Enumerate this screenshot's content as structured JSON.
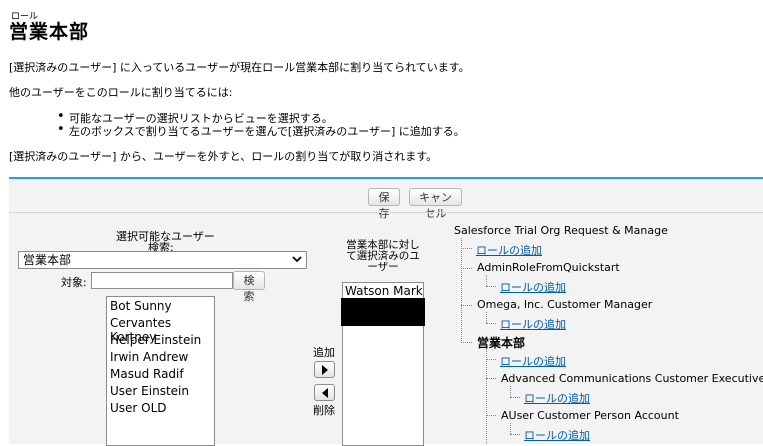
{
  "header": {
    "breadcrumb": "ロール",
    "title": "営業本部"
  },
  "intro": {
    "line1": "[選択済みのユーザー] に入っているユーザーが現在ロール営業本部に割り当てられています。",
    "line2": "他のユーザーをこのロールに割り当てるには:",
    "bullets": [
      "可能なユーザーの選択リストからビューを選択する。",
      "左のボックスで割り当てるユーザーを選んで[選択済みのユーザー] に追加する。"
    ],
    "line3": "[選択済みのユーザー] から、ユーザーを外すと、ロールの割り当てが取り消されます。"
  },
  "toolbar": {
    "save_label": "保存",
    "cancel_label": "キャンセル"
  },
  "available": {
    "heading_line1": "選択可能なユーザー",
    "heading_line2": "検索:",
    "view_selected": "営業本部",
    "target_label": "対象:",
    "search_value": "",
    "search_button": "検索",
    "users": [
      "Bot Sunny",
      "Cervantes Kortney",
      "Helper Einstein",
      "Irwin Andrew",
      "Masud Radif",
      "User Einstein",
      "User OLD"
    ]
  },
  "mover": {
    "add_label": "追加",
    "remove_label": "削除"
  },
  "selected": {
    "heading_line1": "営業本部に対し",
    "heading_line2": "て選択済みのユ",
    "heading_line3": "ーザー",
    "users": [
      "Watson Mark"
    ]
  },
  "tree": {
    "root": "Salesforce Trial Org Request & Manage",
    "add_role_label": "ロールの追加",
    "nodes": [
      "AdminRoleFromQuickstart",
      "Omega, Inc. Customer Manager",
      "営業本部",
      "Advanced Communications Customer Executive",
      "AUser Customer Person Account"
    ]
  },
  "colors": {
    "accent": "#22a2d0",
    "link": "#015ba7",
    "panel_bg": "#f3f3f3"
  }
}
